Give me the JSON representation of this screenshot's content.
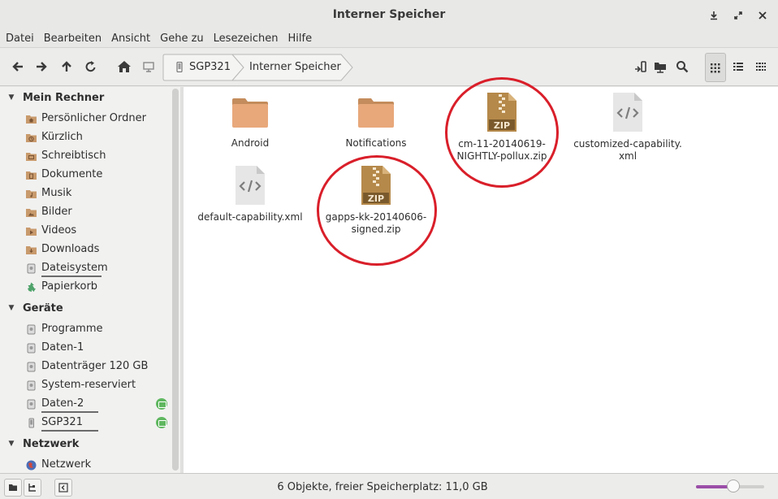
{
  "window": {
    "title": "Interner Speicher"
  },
  "menu": [
    "Datei",
    "Bearbeiten",
    "Ansicht",
    "Gehe zu",
    "Lesezeichen",
    "Hilfe"
  ],
  "breadcrumb": {
    "device": "SGP321",
    "current": "Interner Speicher"
  },
  "sidebar": {
    "sections": [
      {
        "title": "Mein Rechner",
        "items": [
          {
            "label": "Persönlicher Ordner",
            "icon": "home-folder-icon"
          },
          {
            "label": "Kürzlich",
            "icon": "recent-folder-icon"
          },
          {
            "label": "Schreibtisch",
            "icon": "desktop-folder-icon"
          },
          {
            "label": "Dokumente",
            "icon": "documents-folder-icon"
          },
          {
            "label": "Musik",
            "icon": "music-folder-icon"
          },
          {
            "label": "Bilder",
            "icon": "pictures-folder-icon"
          },
          {
            "label": "Videos",
            "icon": "videos-folder-icon"
          },
          {
            "label": "Downloads",
            "icon": "downloads-folder-icon"
          },
          {
            "label": "Dateisystem",
            "icon": "drive-icon"
          },
          {
            "label": "Papierkorb",
            "icon": "trash-icon"
          }
        ]
      },
      {
        "title": "Geräte",
        "items": [
          {
            "label": "Programme",
            "icon": "drive-icon"
          },
          {
            "label": "Daten-1",
            "icon": "drive-icon"
          },
          {
            "label": "Datenträger 120 GB",
            "icon": "drive-icon"
          },
          {
            "label": "System-reserviert",
            "icon": "drive-icon"
          },
          {
            "label": "Daten-2",
            "icon": "drive-icon"
          },
          {
            "label": "SGP321",
            "icon": "phone-icon"
          }
        ]
      },
      {
        "title": "Netzwerk",
        "items": [
          {
            "label": "Netzwerk",
            "icon": "network-icon"
          }
        ]
      }
    ]
  },
  "files": [
    {
      "name": "Android",
      "type": "folder"
    },
    {
      "name": "Notifications",
      "type": "folder"
    },
    {
      "name": "cm-11-20140619-NIGHTLY-pollux.zip",
      "name_line1": "cm-11-20140619-",
      "name_line2": "NIGHTLY-pollux.zip",
      "type": "zip",
      "badge": "ZIP"
    },
    {
      "name": "customized-capability.xml",
      "name_line1": "customized-capability.",
      "name_line2": "xml",
      "type": "xml"
    },
    {
      "name": "default-capability.xml",
      "type": "xml"
    },
    {
      "name": "gapps-kk-20140606-signed.zip",
      "name_line1": "gapps-kk-20140606-",
      "name_line2": "signed.zip",
      "type": "zip",
      "badge": "ZIP"
    }
  ],
  "status": {
    "text": "6 Objekte, freier Speicherplatz: 11,0 GB"
  },
  "zoom": {
    "level": 0.55
  },
  "colors": {
    "accent": "#9b4ea8",
    "folder": "#e8a87a",
    "zip": "#b5894a",
    "annotation": "#d91f2a"
  }
}
